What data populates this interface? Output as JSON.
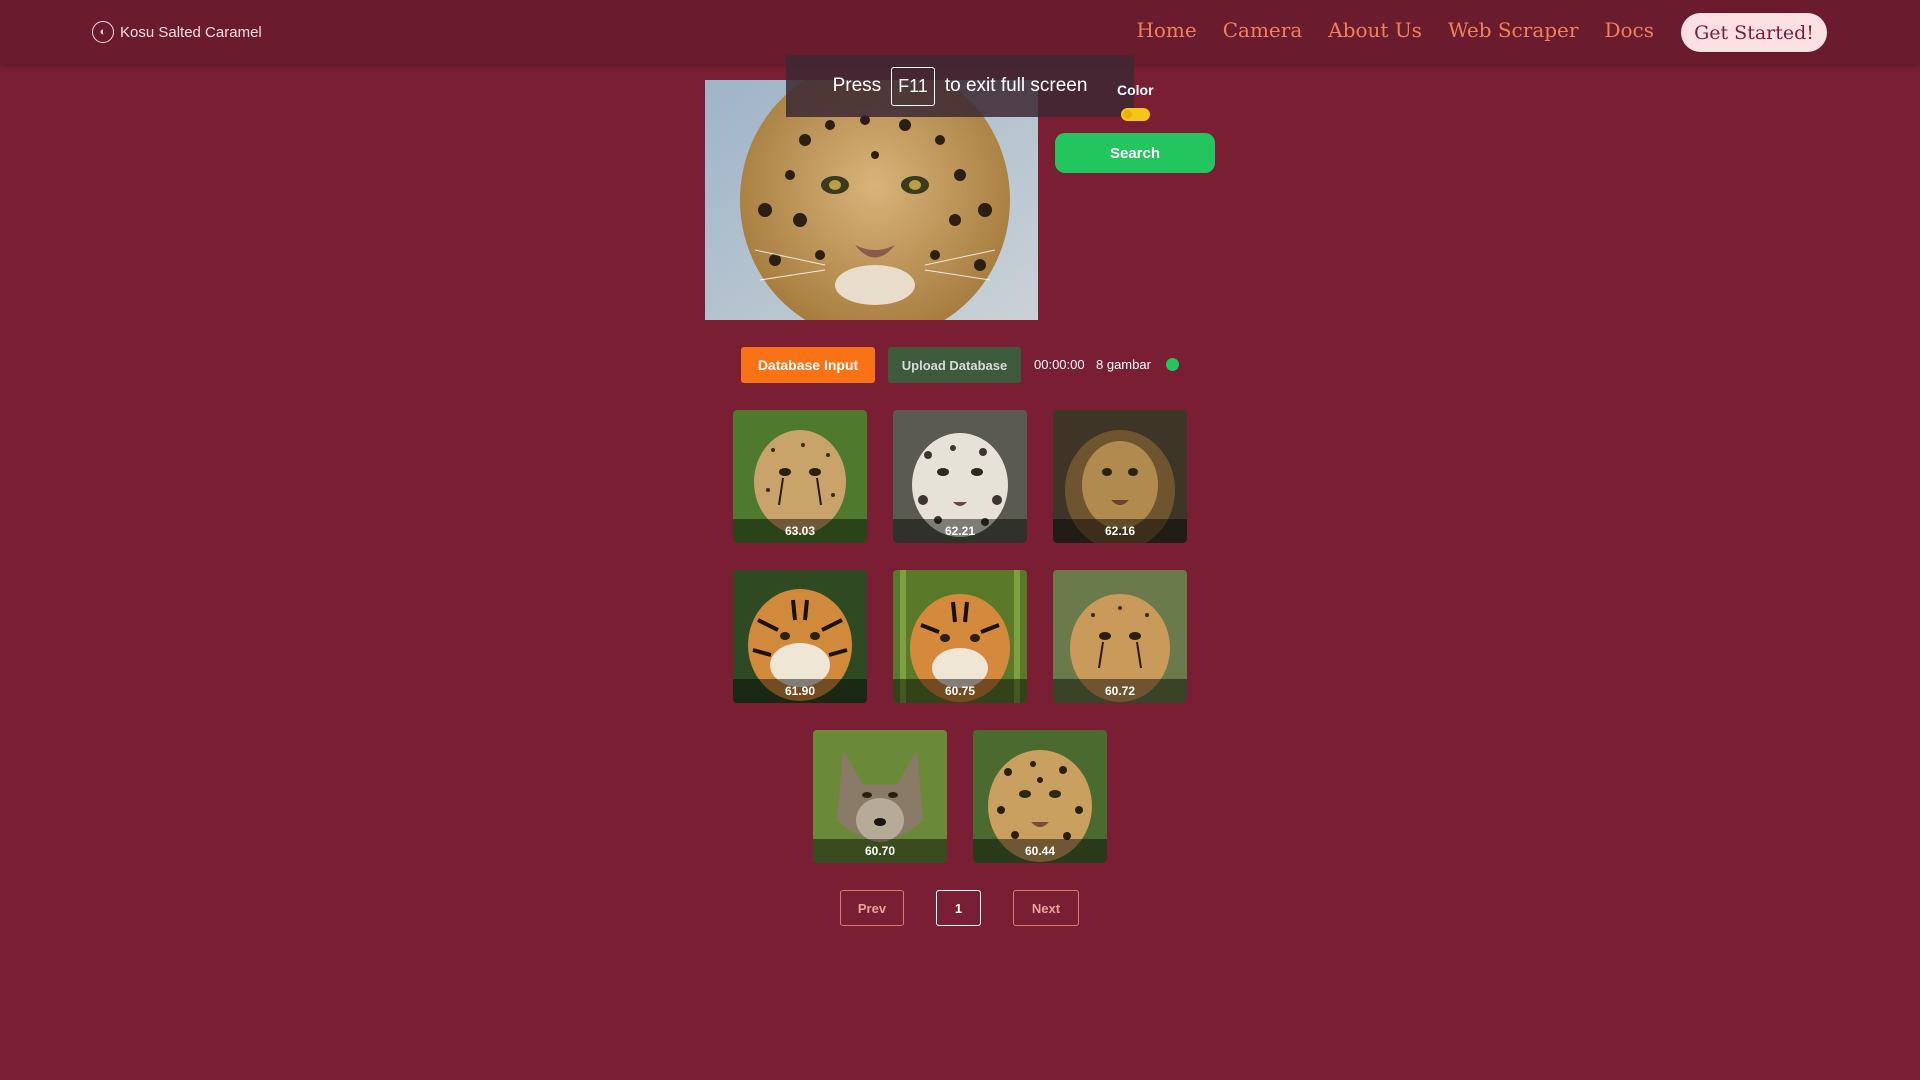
{
  "navbar": {
    "brand": "Kosu Salted Caramel",
    "links": [
      "Home",
      "Camera",
      "About Us",
      "Web Scraper",
      "Docs"
    ],
    "cta": "Get Started!"
  },
  "fullscreen_toast": {
    "press": "Press",
    "key": "F11",
    "message": "to exit full screen"
  },
  "controls": {
    "color_label": "Color",
    "color_toggle_on": true,
    "search_label": "Search"
  },
  "toolbar": {
    "database_input": "Database Input",
    "upload_database": "Upload Database",
    "timer": "00:00:00",
    "count": "8 gambar",
    "status_color": "#22c55e"
  },
  "results": [
    {
      "animal": "cheetah",
      "score": "63.03"
    },
    {
      "animal": "snow-leopard",
      "score": "62.21"
    },
    {
      "animal": "lion",
      "score": "62.16"
    },
    {
      "animal": "tiger",
      "score": "61.90"
    },
    {
      "animal": "tiger",
      "score": "60.75"
    },
    {
      "animal": "cheetah",
      "score": "60.72"
    },
    {
      "animal": "wolf",
      "score": "60.70"
    },
    {
      "animal": "jaguar",
      "score": "60.44"
    }
  ],
  "pagination": {
    "prev": "Prev",
    "current": "1",
    "next": "Next"
  },
  "colors": {
    "background": "#7a1f33",
    "nav_link": "#f0805a",
    "accent_orange": "#f97316",
    "search_green": "#22c55e"
  }
}
